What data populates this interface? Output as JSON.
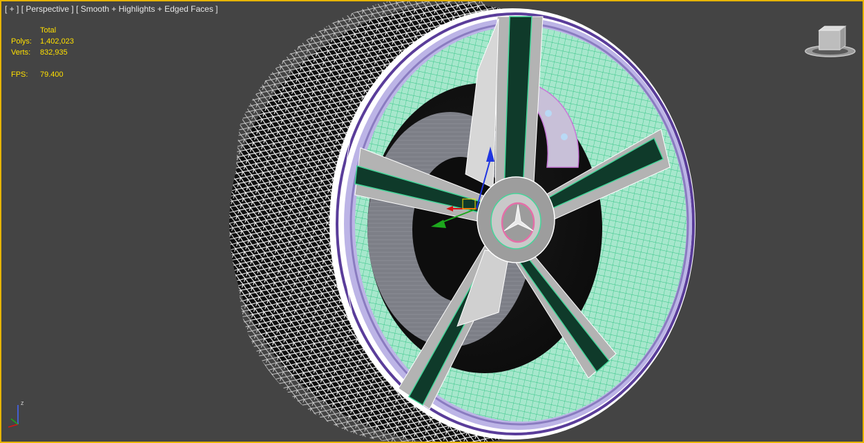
{
  "viewport": {
    "label_plus": "[ + ]",
    "label_view": "[ Perspective ]",
    "label_mode": "[ Smooth + Highlights + Edged Faces ]"
  },
  "stats": {
    "header": "Total",
    "polys_label": "Polys:",
    "polys_value": "1,402,023",
    "verts_label": "Verts:",
    "verts_value": "832,935",
    "fps_label": "FPS:",
    "fps_value": "79.400"
  },
  "axis": {
    "z_label": "z"
  },
  "colors": {
    "viewport_bg": "#444444",
    "active_border": "#e6b400",
    "stats_text": "#ffe000",
    "wire_white": "#ffffff",
    "wire_green": "#45d69a",
    "rim_purple": "#8a7cc0",
    "caliper_pink": "#c878d8"
  },
  "icons": {
    "viewcube": "viewcube-icon",
    "gizmo": "move-gizmo-icon",
    "axis": "world-axis-icon"
  }
}
